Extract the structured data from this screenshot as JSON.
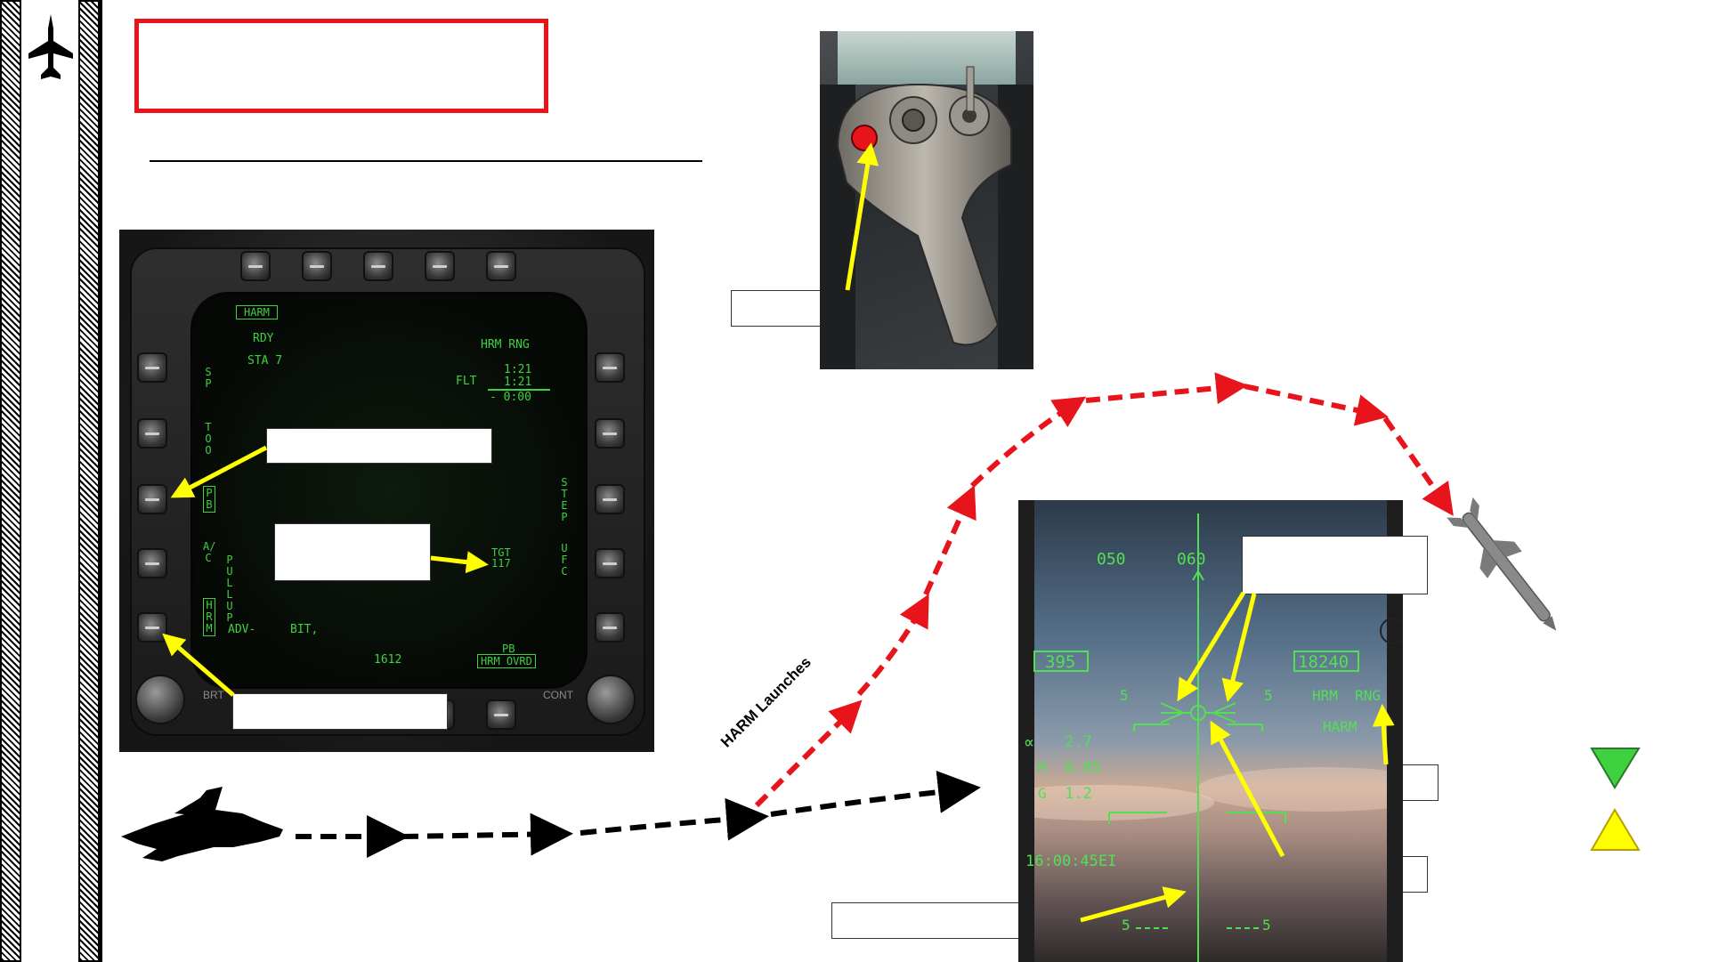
{
  "mfd": {
    "top_label": "HARM",
    "rdy": "RDY",
    "sta": "STA 7",
    "hrm_rng": "HRM RNG",
    "flt": "FLT",
    "time1": "1:21",
    "time2": "1:21",
    "time3": "- 0:00",
    "left_sp": "SP",
    "left_too": "TOO",
    "left_pb": "PB",
    "left_ac": "A/C",
    "left_pullup": "PULLUP",
    "left_hrm": "HRM",
    "adv": "ADV-",
    "bit": "BIT,",
    "tgt": "TGT",
    "tgt_num": "117",
    "right_step": "STEP",
    "right_ufc": "UFC",
    "pb_bottom": "PB",
    "hrm_ovrd": "HRM OVRD",
    "code": "1612",
    "brt": "BRT",
    "cont": "CONT"
  },
  "hud": {
    "heading_left": "050",
    "heading_right": "060",
    "airspeed": "395",
    "altitude": "18240",
    "hrm_rng": "HRM  RNG",
    "harm": "HARM",
    "alpha_sym": "∝",
    "alpha_val": "2.7",
    "mach_label": "M",
    "mach_val": "0.85",
    "g_label": "G",
    "g_val": "1.2",
    "time": "16:00:45EI",
    "pitch_left": "5",
    "pitch_right": "5",
    "bottom_left": "5",
    "bottom_right": "5"
  },
  "path_label": "HARM Launches",
  "colors": {
    "accent_red": "#e8141b",
    "arrow_yellow": "#ffff00",
    "mfd_green": "#3fd13f",
    "hud_green": "#52e052",
    "nav_green": "#3fd13f"
  },
  "icons": {
    "sidebar": "jet-silhouette-icon",
    "aircraft": "fa18-silhouette-icon",
    "missile": "harm-missile-icon",
    "nav_down": "triangle-down-icon",
    "nav_up": "triangle-up-icon"
  }
}
